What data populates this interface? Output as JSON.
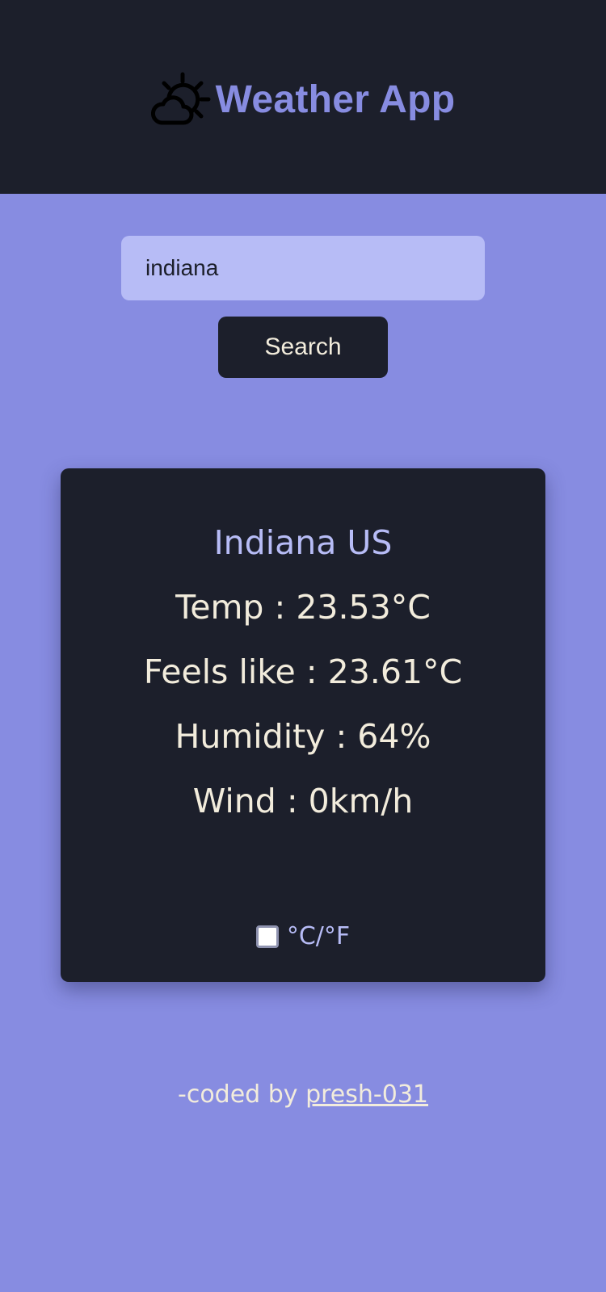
{
  "header": {
    "title": "Weather App",
    "icon": "partly-cloudy-icon"
  },
  "search": {
    "value": "indiana",
    "button_label": "Search"
  },
  "weather": {
    "location": "Indiana US",
    "temp": "Temp : 23.53°C",
    "feels_like": "Feels like : 23.61°C",
    "humidity": "Humidity : 64%",
    "wind": "Wind : 0km/h"
  },
  "unit_toggle": {
    "label": "°C/°F",
    "checked": false
  },
  "footer": {
    "prefix": "-coded by ",
    "link_text": "presh-031"
  },
  "colors": {
    "background": "#878ce1",
    "dark": "#1c1f2b",
    "accent": "#878ce1",
    "input_bg": "#b7bcf6",
    "text_light": "#f2ecdc"
  }
}
